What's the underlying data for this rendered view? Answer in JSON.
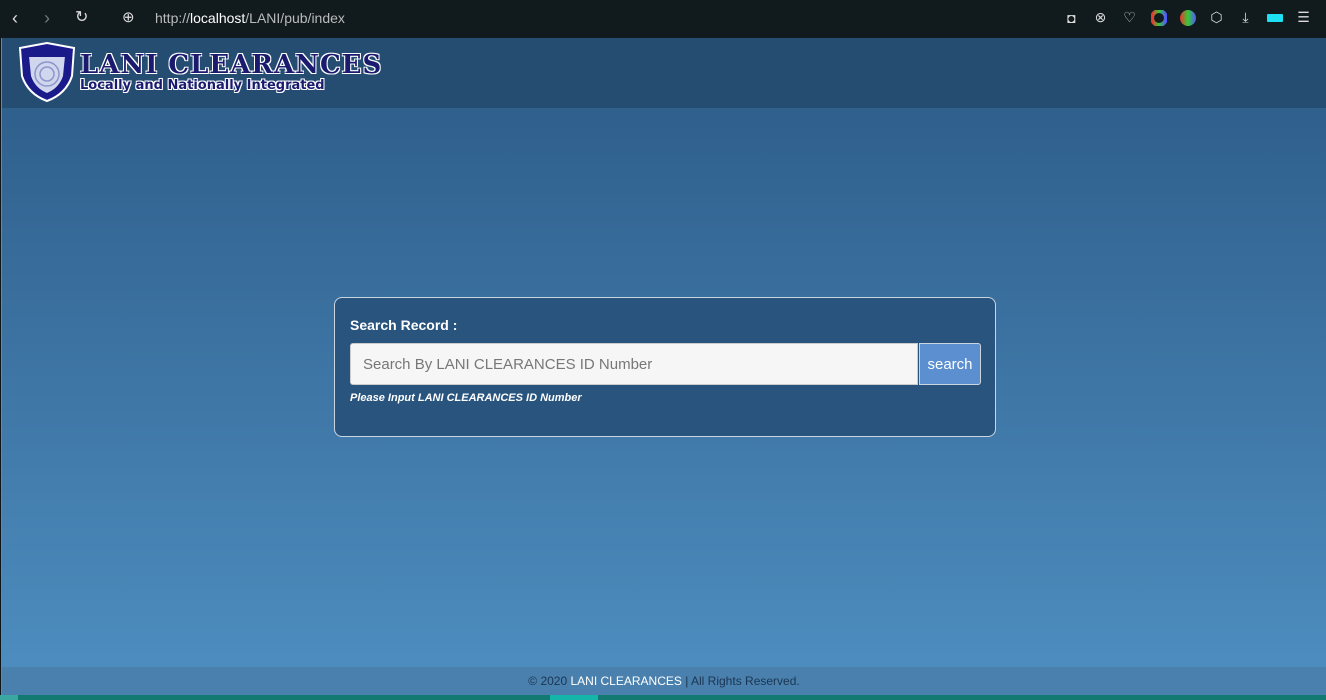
{
  "browser": {
    "url_prefix": "http://",
    "url_host": "localhost",
    "url_path": "/LANI/pub/index",
    "icons": [
      "back-icon",
      "forward-icon",
      "reload-icon",
      "globe-icon",
      "camera-icon",
      "shield-x-icon",
      "heart-icon",
      "color-wheel-icon",
      "color-picker-icon",
      "cube-icon",
      "download-icon",
      "battery-icon",
      "settings-sliders-icon"
    ]
  },
  "header": {
    "logo_badge": "LANI",
    "logo_title": "LANI CLEARANCES",
    "logo_subtitle": "Locally and Nationally Integrated"
  },
  "search": {
    "label": "Search Record :",
    "placeholder": "Search By LANI CLEARANCES ID Number",
    "value": "",
    "button": "search",
    "hint": "Please Input LANI CLEARANCES ID Number"
  },
  "footer": {
    "copyright": "© 2020",
    "brand": "LANI CLEARANCES",
    "rights": "| All Rights Reserved."
  },
  "colors": {
    "header": "#254d72",
    "card": "#28547e",
    "button": "#5b8fd0"
  }
}
